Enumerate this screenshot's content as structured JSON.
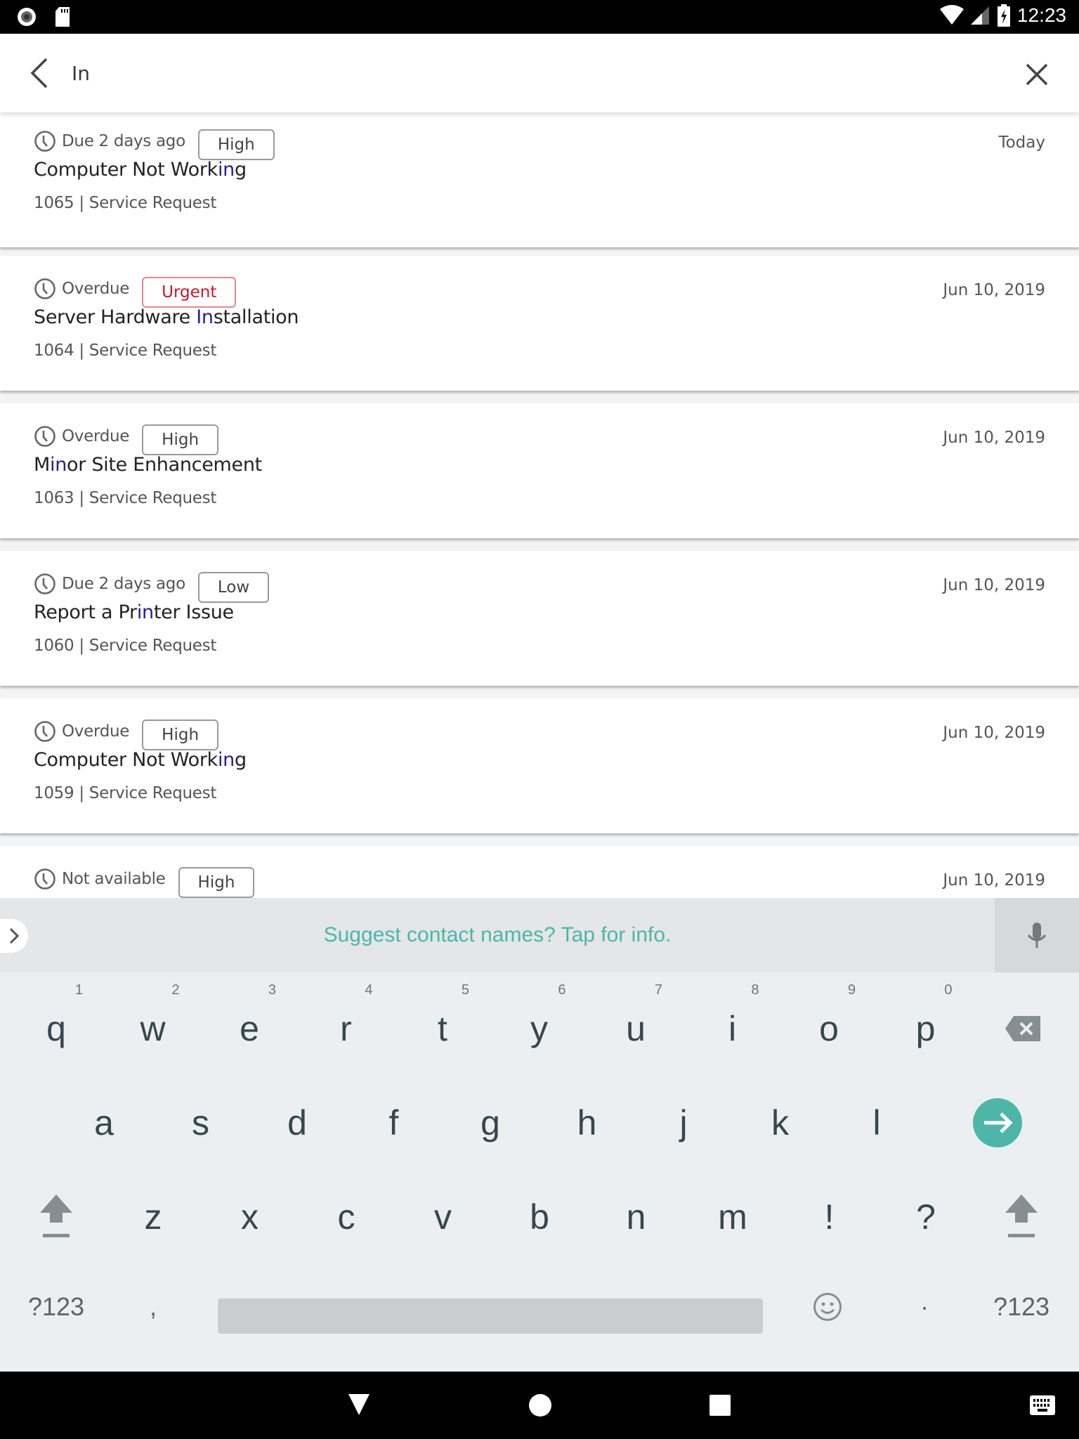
{
  "status_bar": {
    "time": "12:23",
    "left_icons": [
      "record-icon",
      "sd-card-icon"
    ],
    "right_icons": [
      "wifi-icon",
      "signal-icon",
      "battery-charging-icon"
    ]
  },
  "search": {
    "query": "In",
    "back_icon": "back-arrow-icon",
    "clear_icon": "close-icon"
  },
  "results": [
    {
      "due": "Due 2 days ago",
      "priority": "High",
      "title_before": "Computer Not Work",
      "title_match": "in",
      "title_after": "g",
      "id": "1065",
      "type": "Service Request",
      "sub": "1065 | Service Request",
      "date": "Today"
    },
    {
      "due": "Overdue",
      "priority": "Urgent",
      "title_before": "Server Hardware ",
      "title_match": "In",
      "title_after": "stallation",
      "id": "1064",
      "type": "Service Request",
      "sub": "1064 | Service Request",
      "date": "Jun 10, 2019"
    },
    {
      "due": "Overdue",
      "priority": "High",
      "title_before": "M",
      "title_match": "in",
      "title_after": "or Site Enhancement",
      "id": "1063",
      "type": "Service Request",
      "sub": "1063 | Service Request",
      "date": "Jun 10, 2019"
    },
    {
      "due": "Due 2 days ago",
      "priority": "Low",
      "title_before": "Report a Pr",
      "title_match": "in",
      "title_after": "ter Issue",
      "id": "1060",
      "type": "Service Request",
      "sub": "1060 | Service Request",
      "date": "Jun 10, 2019"
    },
    {
      "due": "Overdue",
      "priority": "High",
      "title_before": "Computer Not Work",
      "title_match": "in",
      "title_after": "g",
      "id": "1059",
      "type": "Service Request",
      "sub": "1059 | Service Request",
      "date": "Jun 10, 2019"
    },
    {
      "due": "Not available",
      "priority": "High",
      "title_before": "",
      "title_match": "",
      "title_after": "",
      "id": "",
      "type": "",
      "sub": "",
      "date": "Jun 10, 2019"
    }
  ],
  "keyboard": {
    "suggestion": "Suggest contact names? Tap for info.",
    "row1": [
      "q",
      "w",
      "e",
      "r",
      "t",
      "y",
      "u",
      "i",
      "o",
      "p"
    ],
    "row1_hints": [
      "1",
      "2",
      "3",
      "4",
      "5",
      "6",
      "7",
      "8",
      "9",
      "0"
    ],
    "row2": [
      "a",
      "s",
      "d",
      "f",
      "g",
      "h",
      "j",
      "k",
      "l"
    ],
    "row3": [
      "z",
      "x",
      "c",
      "v",
      "b",
      "n",
      "m",
      "!",
      "?"
    ],
    "symbols_label": "?123",
    "comma": ",",
    "period": "·",
    "accent_color": "#4db6a9"
  },
  "colors": {
    "highlight": "#2b1e91",
    "urgent": "#c8182a",
    "urgent_border": "#e08890"
  }
}
